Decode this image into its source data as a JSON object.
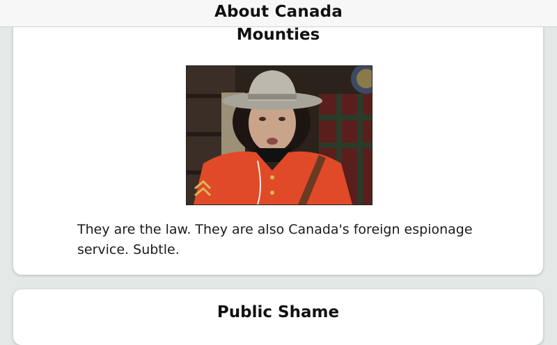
{
  "navbar": {
    "title": "About Canada"
  },
  "cards": [
    {
      "title": "Mounties",
      "image_alt": "mountie-photo",
      "text": "They are the law. They are also Canada's foreign espionage service. Subtle."
    },
    {
      "title": "Public Shame"
    }
  ]
}
